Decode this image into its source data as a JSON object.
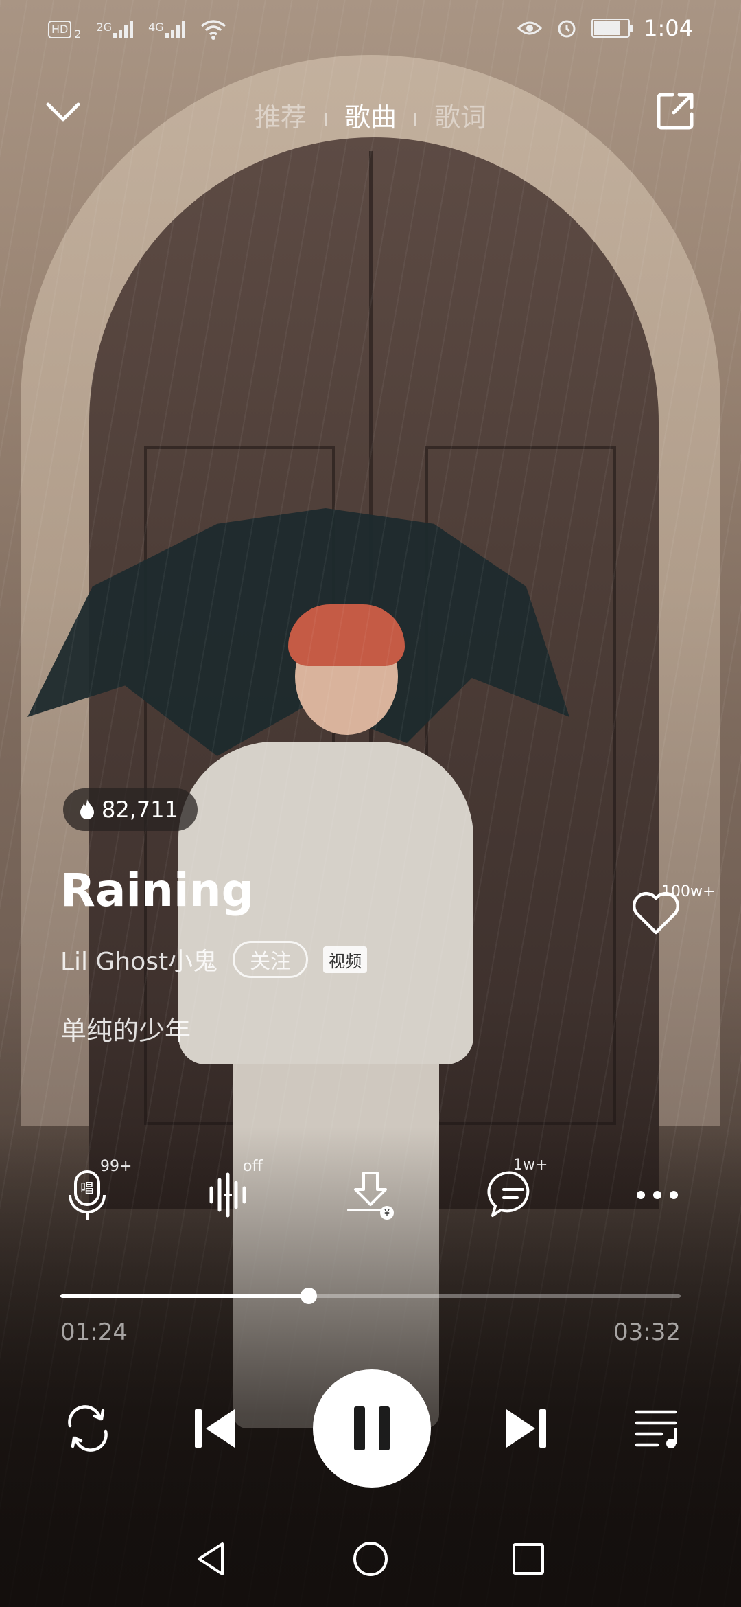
{
  "status_bar": {
    "network_hd": "HD",
    "sim2": "2",
    "net_2g": "2G",
    "net_4g": "4G",
    "time": "1:04",
    "battery_level": 0.7
  },
  "header": {
    "tabs": [
      "推荐",
      "歌曲",
      "歌词"
    ],
    "active_tab": "歌曲"
  },
  "song": {
    "hot_count": "82,711",
    "title": "Raining",
    "artist": "Lil Ghost小鬼",
    "follow_label": "关注",
    "video_tag": "视频",
    "album": "单纯的少年",
    "like_count": "100w+"
  },
  "actions": {
    "sing_badge": "99+",
    "effect_badge": "off",
    "comment_badge": "1w+"
  },
  "player": {
    "current_time": "01:24",
    "total_time": "03:32",
    "progress": 0.4
  },
  "icons": {
    "back": "chevron-down-icon",
    "share": "share-icon",
    "like": "heart-icon",
    "sing": "microphone-icon",
    "effect": "sound-effect-icon",
    "download": "download-icon",
    "comment": "comment-icon",
    "more": "more-icon",
    "repeat": "repeat-icon",
    "prev": "previous-icon",
    "pause": "pause-icon",
    "next": "next-icon",
    "playlist": "playlist-icon"
  }
}
